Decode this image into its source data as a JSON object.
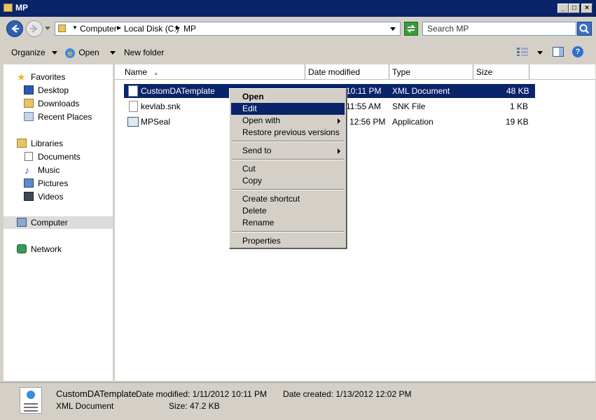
{
  "window": {
    "title": "MP"
  },
  "address": {
    "crumbs": [
      "Computer",
      "Local Disk (C:)",
      "MP"
    ]
  },
  "search": {
    "placeholder": "Search MP"
  },
  "toolbar": {
    "organize": "Organize",
    "open": "Open",
    "new_folder": "New folder"
  },
  "nav": {
    "favorites": "Favorites",
    "desktop": "Desktop",
    "downloads": "Downloads",
    "recent": "Recent Places",
    "libraries": "Libraries",
    "documents": "Documents",
    "music": "Music",
    "pictures": "Pictures",
    "videos": "Videos",
    "computer": "Computer",
    "network": "Network"
  },
  "columns": {
    "name": "Name",
    "date": "Date modified",
    "type": "Type",
    "size": "Size"
  },
  "files": [
    {
      "name": "CustomDATemplate",
      "date": "10:11 PM",
      "type": "XML Document",
      "size": "48 KB"
    },
    {
      "name": "kevlab.snk",
      "date": "11:55 AM",
      "type": "SNK File",
      "size": "1 KB"
    },
    {
      "name": "MPSeal",
      "date": "12:56 PM",
      "type": "Application",
      "size": "19 KB"
    }
  ],
  "context_menu": {
    "open": "Open",
    "edit": "Edit",
    "open_with": "Open with",
    "restore": "Restore previous versions",
    "send_to": "Send to",
    "cut": "Cut",
    "copy": "Copy",
    "create_shortcut": "Create shortcut",
    "delete": "Delete",
    "rename": "Rename",
    "properties": "Properties"
  },
  "details": {
    "name": "CustomDATemplate",
    "date_modified": "Date modified: 1/11/2012 10:11 PM",
    "date_created": "Date created: 1/13/2012 12:02 PM",
    "type": "XML Document",
    "size": "Size: 47.2 KB"
  },
  "colors": {
    "titlebar": "#0a246a",
    "selection": "#0a246a",
    "chrome": "#d4d0c8"
  }
}
